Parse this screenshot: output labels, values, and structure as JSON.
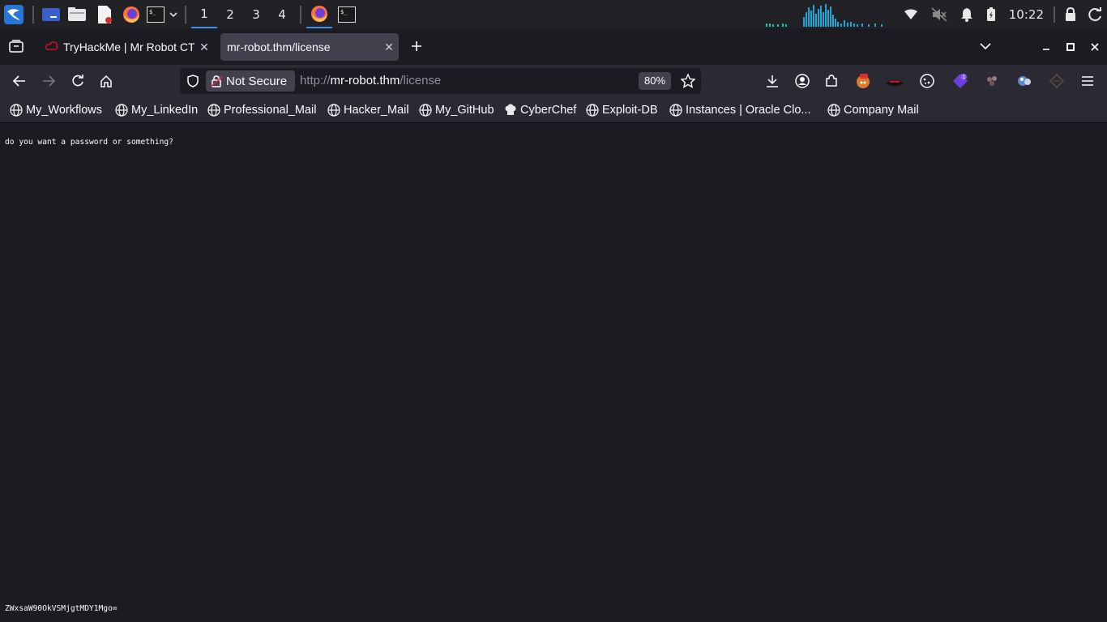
{
  "taskbar": {
    "workspaces": [
      "1",
      "2",
      "3",
      "4"
    ],
    "clock": "10:22"
  },
  "tabs": [
    {
      "title": "TryHackMe | Mr Robot CTF",
      "active": false
    },
    {
      "title": "mr-robot.thm/license",
      "active": true
    }
  ],
  "navbar": {
    "security_label": "Not Secure",
    "url_scheme": "http://",
    "url_host": "mr-robot.thm",
    "url_path": "/license",
    "zoom": "80%"
  },
  "bookmarks": [
    "My_Workflows",
    "My_LinkedIn",
    "Professional_Mail",
    "Hacker_Mail",
    "My_GitHub",
    "CyberChef",
    "Exploit-DB",
    "Instances | Oracle Clo...",
    "Company Mail"
  ],
  "page": {
    "line1": "do you want a password or something?",
    "line2": "ZWxsaW90OkVSMjgtMDY1Mgo="
  },
  "colors": {
    "accent": "#3d8cf0",
    "toolbar": "#2b2a33",
    "page_bg": "#1c1b22"
  }
}
